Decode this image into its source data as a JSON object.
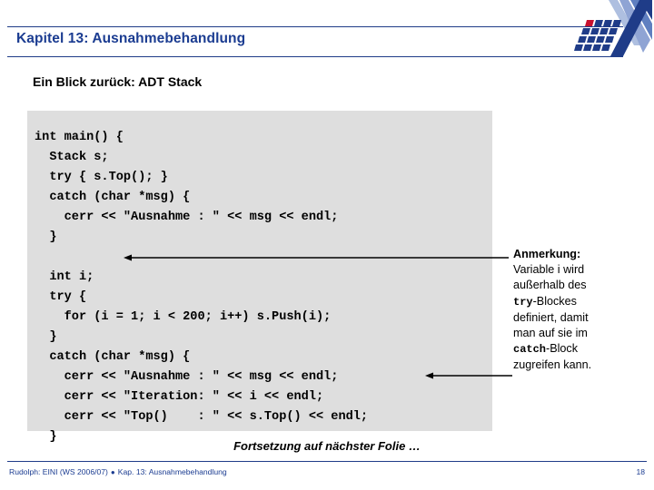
{
  "slide": {
    "title": "Kapitel 13: Ausnahmebehandlung",
    "subtitle": "Ein Blick zurück: ADT Stack",
    "continuation": "Fortsetzung auf nächster Folie …"
  },
  "code": {
    "text": "int main() {\n  Stack s;\n  try { s.Top(); }\n  catch (char *msg) {\n    cerr << \"Ausnahme : \" << msg << endl;\n  }\n\n  int i;\n  try {\n    for (i = 1; i < 200; i++) s.Push(i);\n  }\n  catch (char *msg) {\n    cerr << \"Ausnahme : \" << msg << endl;\n    cerr << \"Iteration: \" << i << endl;\n    cerr << \"Top()    : \" << s.Top() << endl;\n  }"
  },
  "annotation": {
    "heading": "Anmerkung:",
    "line1": "Variable i wird",
    "line2": "außerhalb des",
    "code1": "try",
    "line3": "-Blockes",
    "line4": "definiert, damit",
    "line5": "man auf sie im",
    "code2": "catch",
    "line6": "-Block",
    "line7": "zugreifen kann."
  },
  "footer": {
    "author_course": "Rudolph: EINI (WS 2006/07)",
    "bullet": "●",
    "chapter": "Kap. 13: Ausnahmebehandlung",
    "page_number": "18"
  },
  "colors": {
    "title_blue": "#1b3c91",
    "rule_blue": "#1f3c88",
    "code_background": "#dedede",
    "logo_dark_blue": "#1f3c88",
    "logo_mid_blue": "#5f7fc0",
    "logo_light_blue": "#aebfe0",
    "logo_accent_red": "#c8102e"
  },
  "icons": {
    "logo": "university-logo-icon",
    "arrow_to_int_i": "annotation-arrow-icon",
    "arrow_to_iteration": "annotation-arrow-icon"
  }
}
